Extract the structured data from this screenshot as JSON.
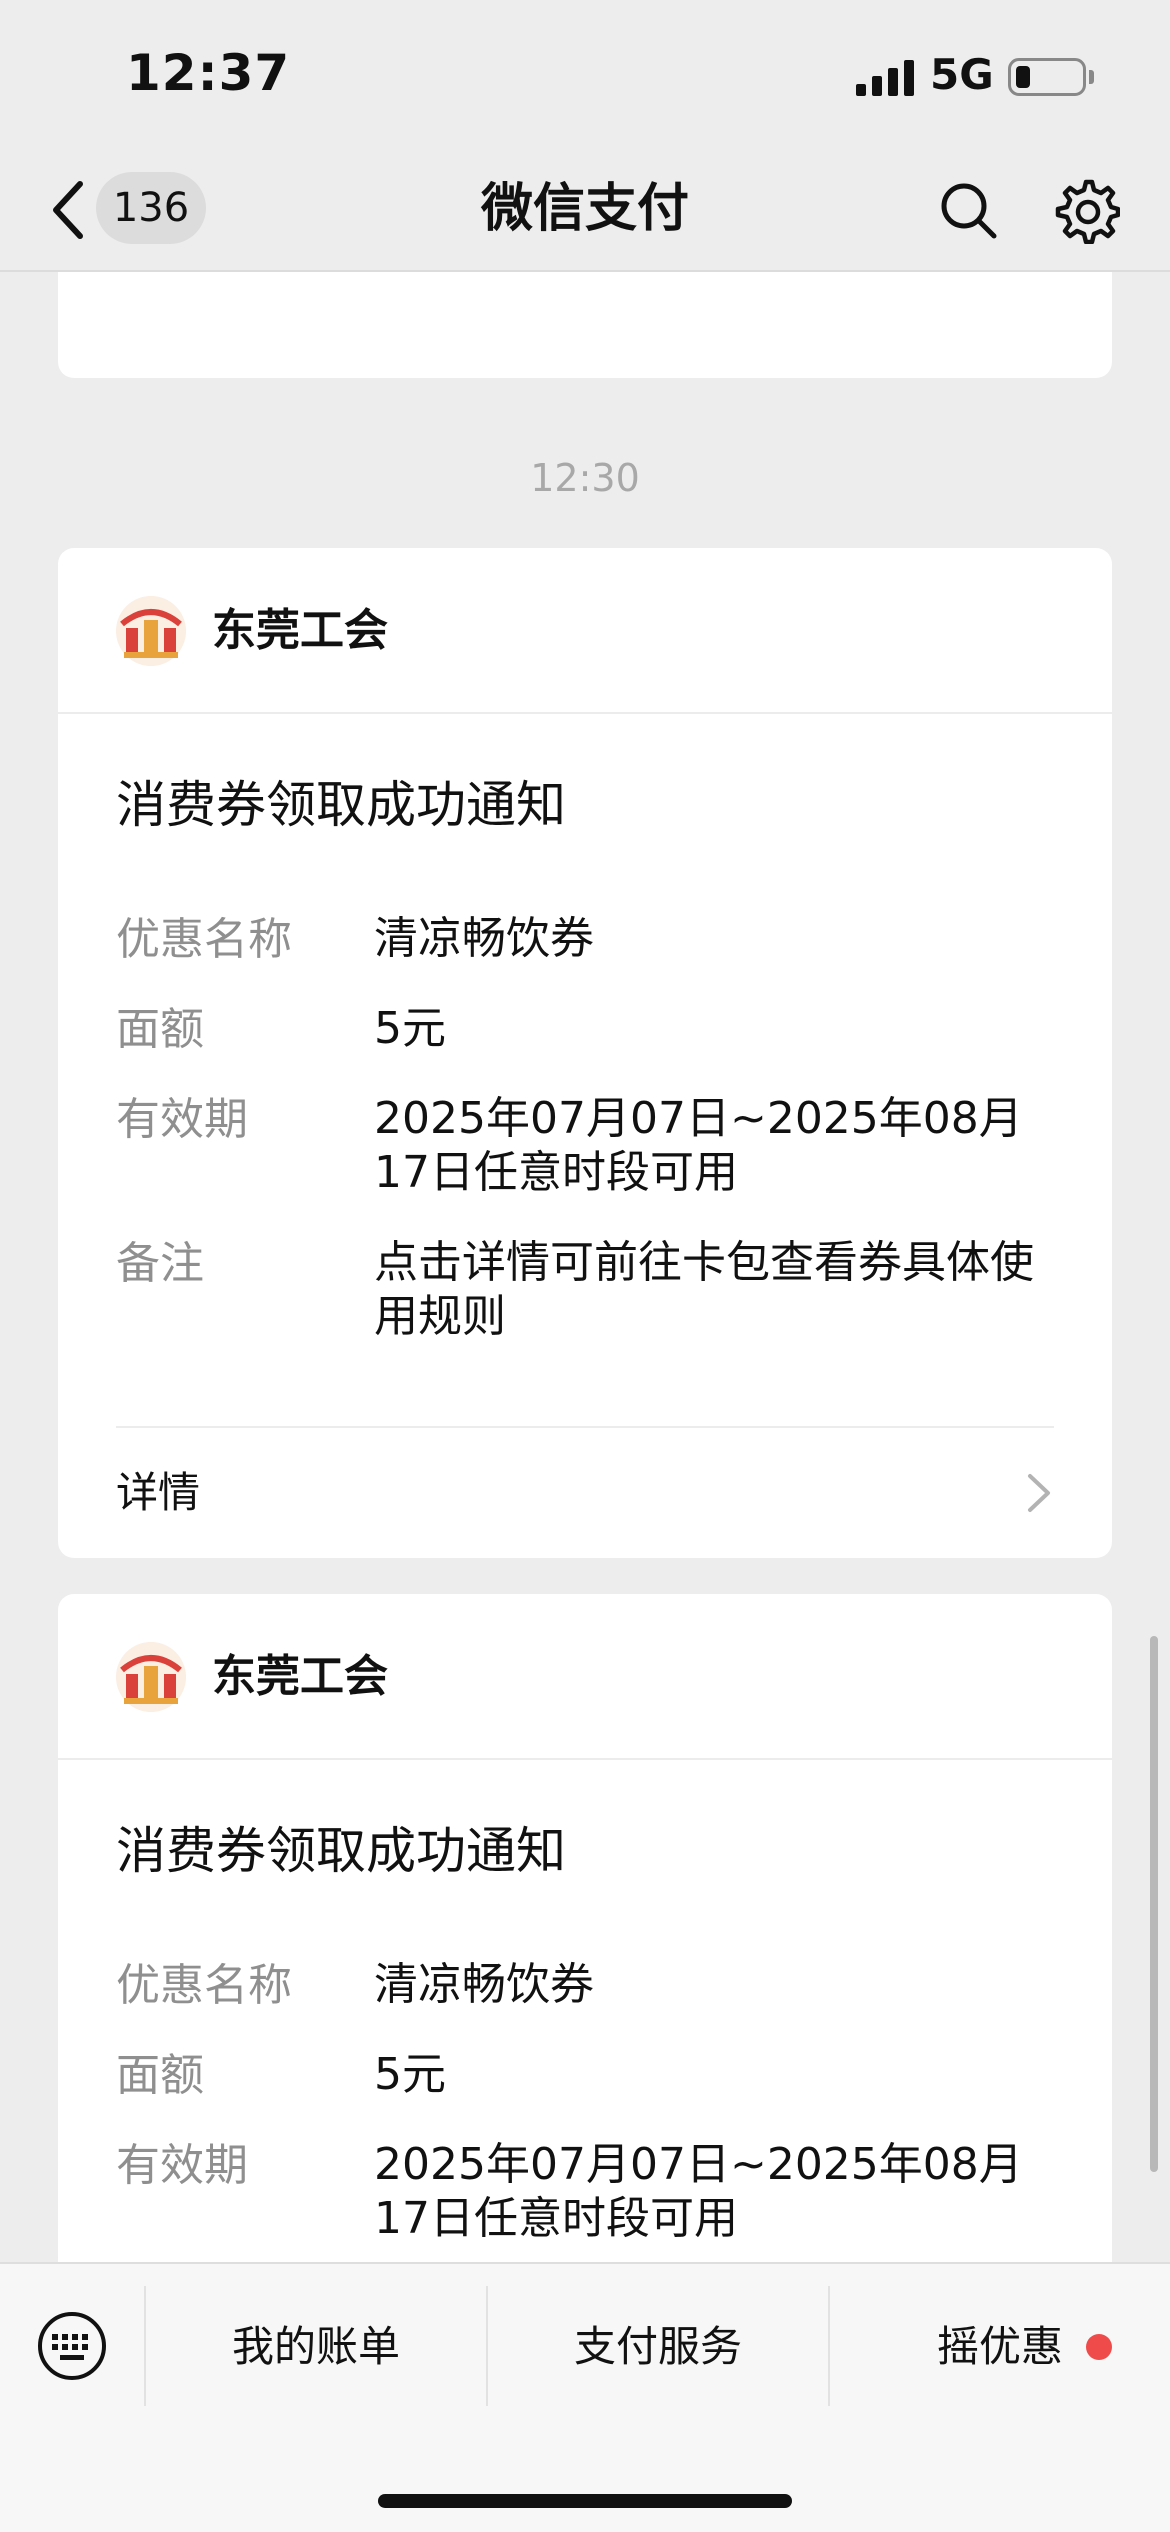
{
  "status_bar": {
    "time": "12:37",
    "network": "5G"
  },
  "nav": {
    "unread_count": "136",
    "title": "微信支付",
    "icons": {
      "back": "chevron-left-icon",
      "search": "search-icon",
      "settings": "gear-icon"
    }
  },
  "chat": {
    "time_separator": "12:30",
    "messages": [
      {
        "org_name": "东莞工会",
        "notice_title": "消费券领取成功通知",
        "fields": [
          {
            "label": "优惠名称",
            "value": "清凉畅饮券"
          },
          {
            "label": "面额",
            "value": "5元"
          },
          {
            "label": "有效期",
            "value": "2025年07月07日~2025年08月17日任意时段可用"
          },
          {
            "label": "备注",
            "value": "点击详情可前往卡包查看券具体使用规则"
          }
        ],
        "detail_label": "详情"
      },
      {
        "org_name": "东莞工会",
        "notice_title": "消费券领取成功通知",
        "fields": [
          {
            "label": "优惠名称",
            "value": "清凉畅饮券"
          },
          {
            "label": "面额",
            "value": "5元"
          },
          {
            "label": "有效期",
            "value": "2025年07月07日~2025年08月17日任意时段可用"
          }
        ]
      }
    ]
  },
  "menu_bar": {
    "items": [
      {
        "label": "我的账单"
      },
      {
        "label": "支付服务"
      },
      {
        "label": "摇优惠"
      }
    ]
  },
  "colors": {
    "background": "#ededed",
    "card": "#ffffff",
    "label_gray": "#8f8f8f",
    "badge_dot": "#f04b4b",
    "logo_red": "#d9413a",
    "logo_gold": "#e8a33c"
  }
}
